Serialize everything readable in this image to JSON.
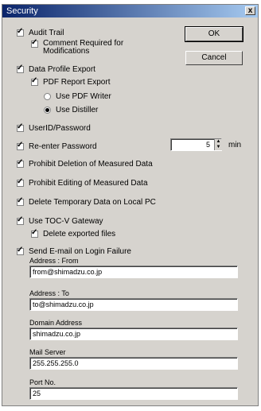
{
  "window": {
    "title": "Security",
    "close_glyph": "x"
  },
  "buttons": {
    "ok": "OK",
    "cancel": "Cancel"
  },
  "options": {
    "audit_trail": "Audit Trail",
    "comment_required": "Comment Required for Modifications",
    "data_profile_export": "Data Profile Export",
    "pdf_report_export": "PDF Report Export",
    "use_pdf_writer": "Use PDF Writer",
    "use_distiller": "Use Distiller",
    "userid_password": "UserID/Password",
    "reenter_password": "Re-enter Password",
    "prohibit_deletion": "Prohibit Deletion of Measured Data",
    "prohibit_editing": "Prohibit Editing of Measured Data",
    "delete_temp": "Delete Temporary Data on Local PC",
    "use_tocv": "Use TOC-V Gateway",
    "delete_exported": "Delete exported files",
    "send_email": "Send E-mail on Login Failure"
  },
  "reenter": {
    "value": "5",
    "unit": "min"
  },
  "email": {
    "from_label": "Address : From",
    "from_value": "from@shimadzu.co.jp",
    "to_label": "Address : To",
    "to_value": "to@shimadzu.co.jp",
    "domain_label": "Domain Address",
    "domain_value": "shimadzu.co.jp",
    "server_label": "Mail Server",
    "server_value": "255.255.255.0",
    "port_label": "Port No.",
    "port_value": "25"
  }
}
